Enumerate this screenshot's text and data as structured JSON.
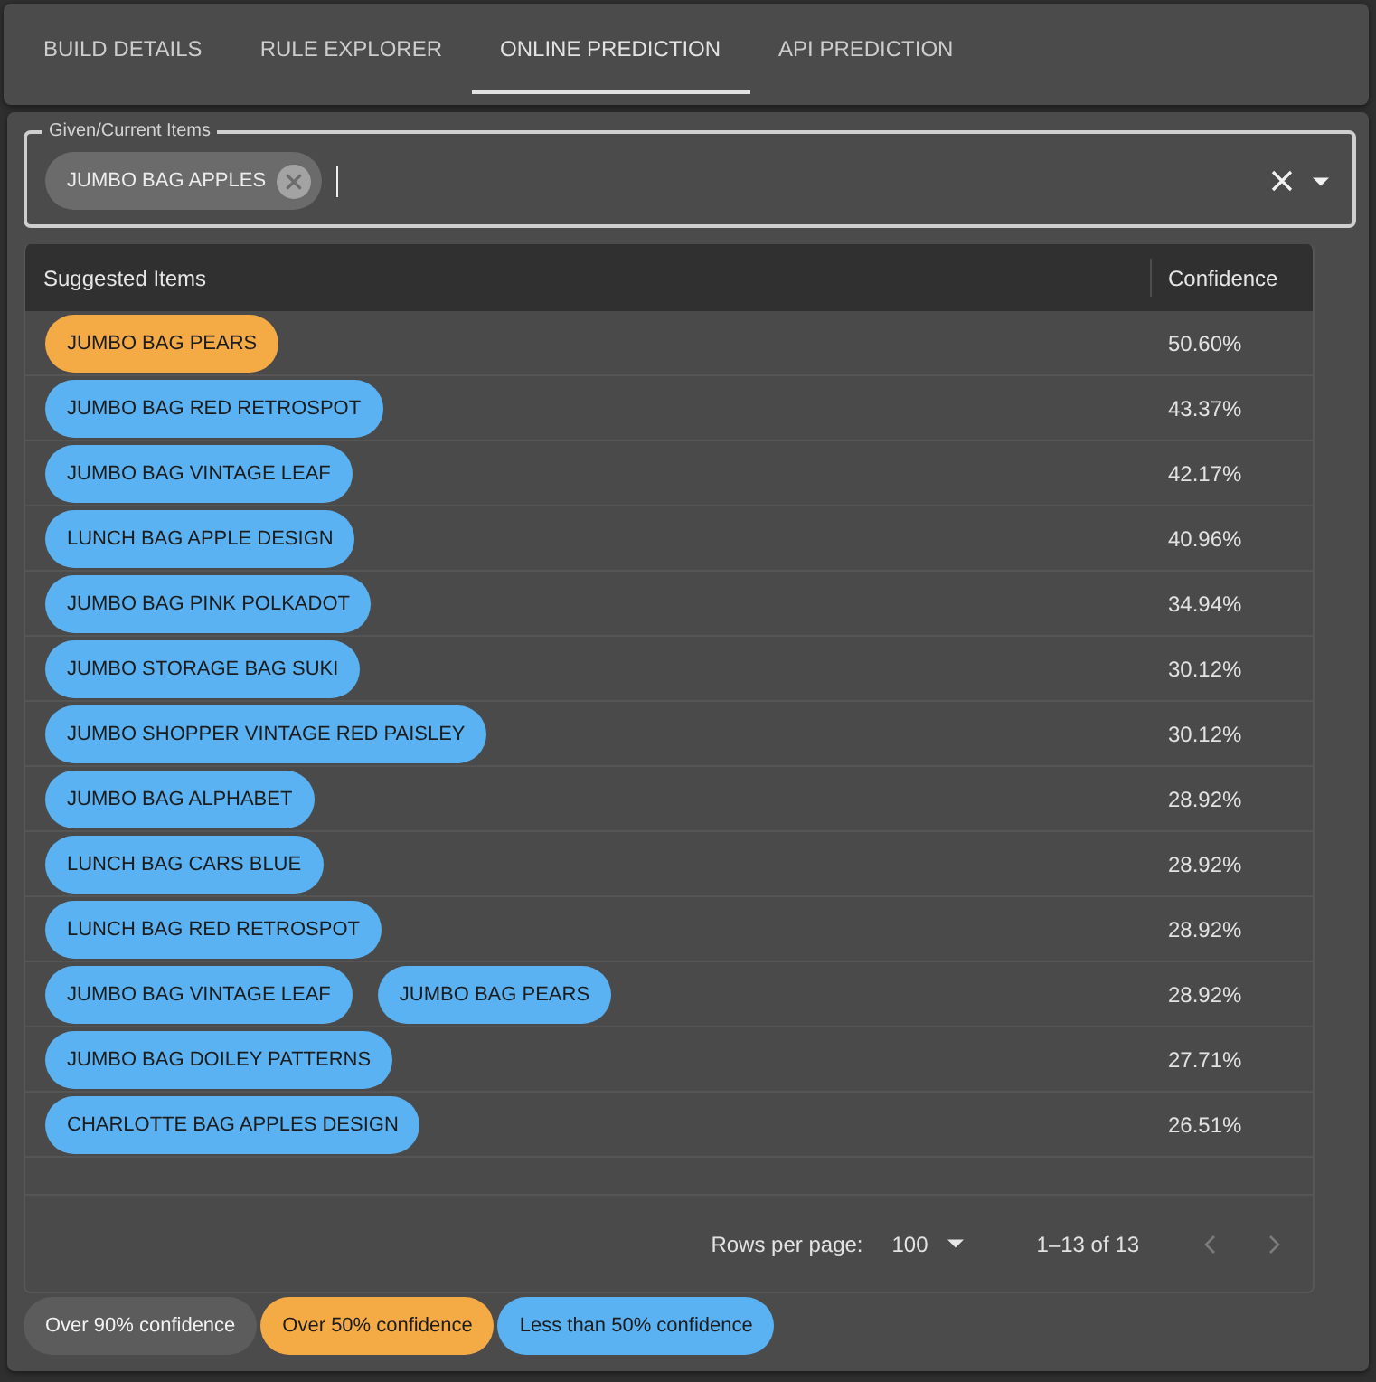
{
  "tabs": [
    {
      "label": "BUILD DETAILS",
      "selected": false
    },
    {
      "label": "RULE EXPLORER",
      "selected": false
    },
    {
      "label": "ONLINE PREDICTION",
      "selected": true
    },
    {
      "label": "API PREDICTION",
      "selected": false
    }
  ],
  "given_items": {
    "label": "Given/Current Items",
    "chips": [
      "JUMBO BAG APPLES"
    ]
  },
  "table": {
    "columns": [
      "Suggested Items",
      "Confidence"
    ],
    "rows": [
      {
        "items": [
          {
            "label": "JUMBO BAG PEARS",
            "color": "#f4ab46"
          }
        ],
        "confidence": "50.60%"
      },
      {
        "items": [
          {
            "label": "JUMBO BAG RED RETROSPOT",
            "color": "#5ab2f2"
          }
        ],
        "confidence": "43.37%"
      },
      {
        "items": [
          {
            "label": "JUMBO BAG VINTAGE LEAF",
            "color": "#5ab2f2"
          }
        ],
        "confidence": "42.17%"
      },
      {
        "items": [
          {
            "label": "LUNCH BAG APPLE DESIGN",
            "color": "#5ab2f2"
          }
        ],
        "confidence": "40.96%"
      },
      {
        "items": [
          {
            "label": "JUMBO BAG PINK POLKADOT",
            "color": "#5ab2f2"
          }
        ],
        "confidence": "34.94%"
      },
      {
        "items": [
          {
            "label": "JUMBO STORAGE BAG SUKI",
            "color": "#5ab2f2"
          }
        ],
        "confidence": "30.12%"
      },
      {
        "items": [
          {
            "label": "JUMBO SHOPPER VINTAGE RED PAISLEY",
            "color": "#5ab2f2"
          }
        ],
        "confidence": "30.12%"
      },
      {
        "items": [
          {
            "label": "JUMBO BAG ALPHABET",
            "color": "#5ab2f2"
          }
        ],
        "confidence": "28.92%"
      },
      {
        "items": [
          {
            "label": "LUNCH BAG CARS BLUE",
            "color": "#5ab2f2"
          }
        ],
        "confidence": "28.92%"
      },
      {
        "items": [
          {
            "label": "LUNCH BAG RED RETROSPOT",
            "color": "#5ab2f2"
          }
        ],
        "confidence": "28.92%"
      },
      {
        "items": [
          {
            "label": "JUMBO BAG VINTAGE LEAF",
            "color": "#5ab2f2"
          },
          {
            "label": "JUMBO BAG PEARS",
            "color": "#5ab2f2"
          }
        ],
        "confidence": "28.92%"
      },
      {
        "items": [
          {
            "label": "JUMBO BAG DOILEY PATTERNS",
            "color": "#5ab2f2"
          }
        ],
        "confidence": "27.71%"
      },
      {
        "items": [
          {
            "label": "CHARLOTTE BAG APPLES DESIGN",
            "color": "#5ab2f2"
          }
        ],
        "confidence": "26.51%"
      }
    ]
  },
  "pagination": {
    "rows_per_page_label": "Rows per page:",
    "rows_per_page": "100",
    "range": "1–13 of 13",
    "prev": {
      "disabled": true
    },
    "next": {
      "disabled": true
    }
  },
  "legend": [
    {
      "label": "Over 90% confidence",
      "color": "#5c5c5c"
    },
    {
      "label": "Over 50% confidence",
      "color": "#f4ab46"
    },
    {
      "label": "Less than 50% confidence",
      "color": "#5ab2f2"
    }
  ]
}
